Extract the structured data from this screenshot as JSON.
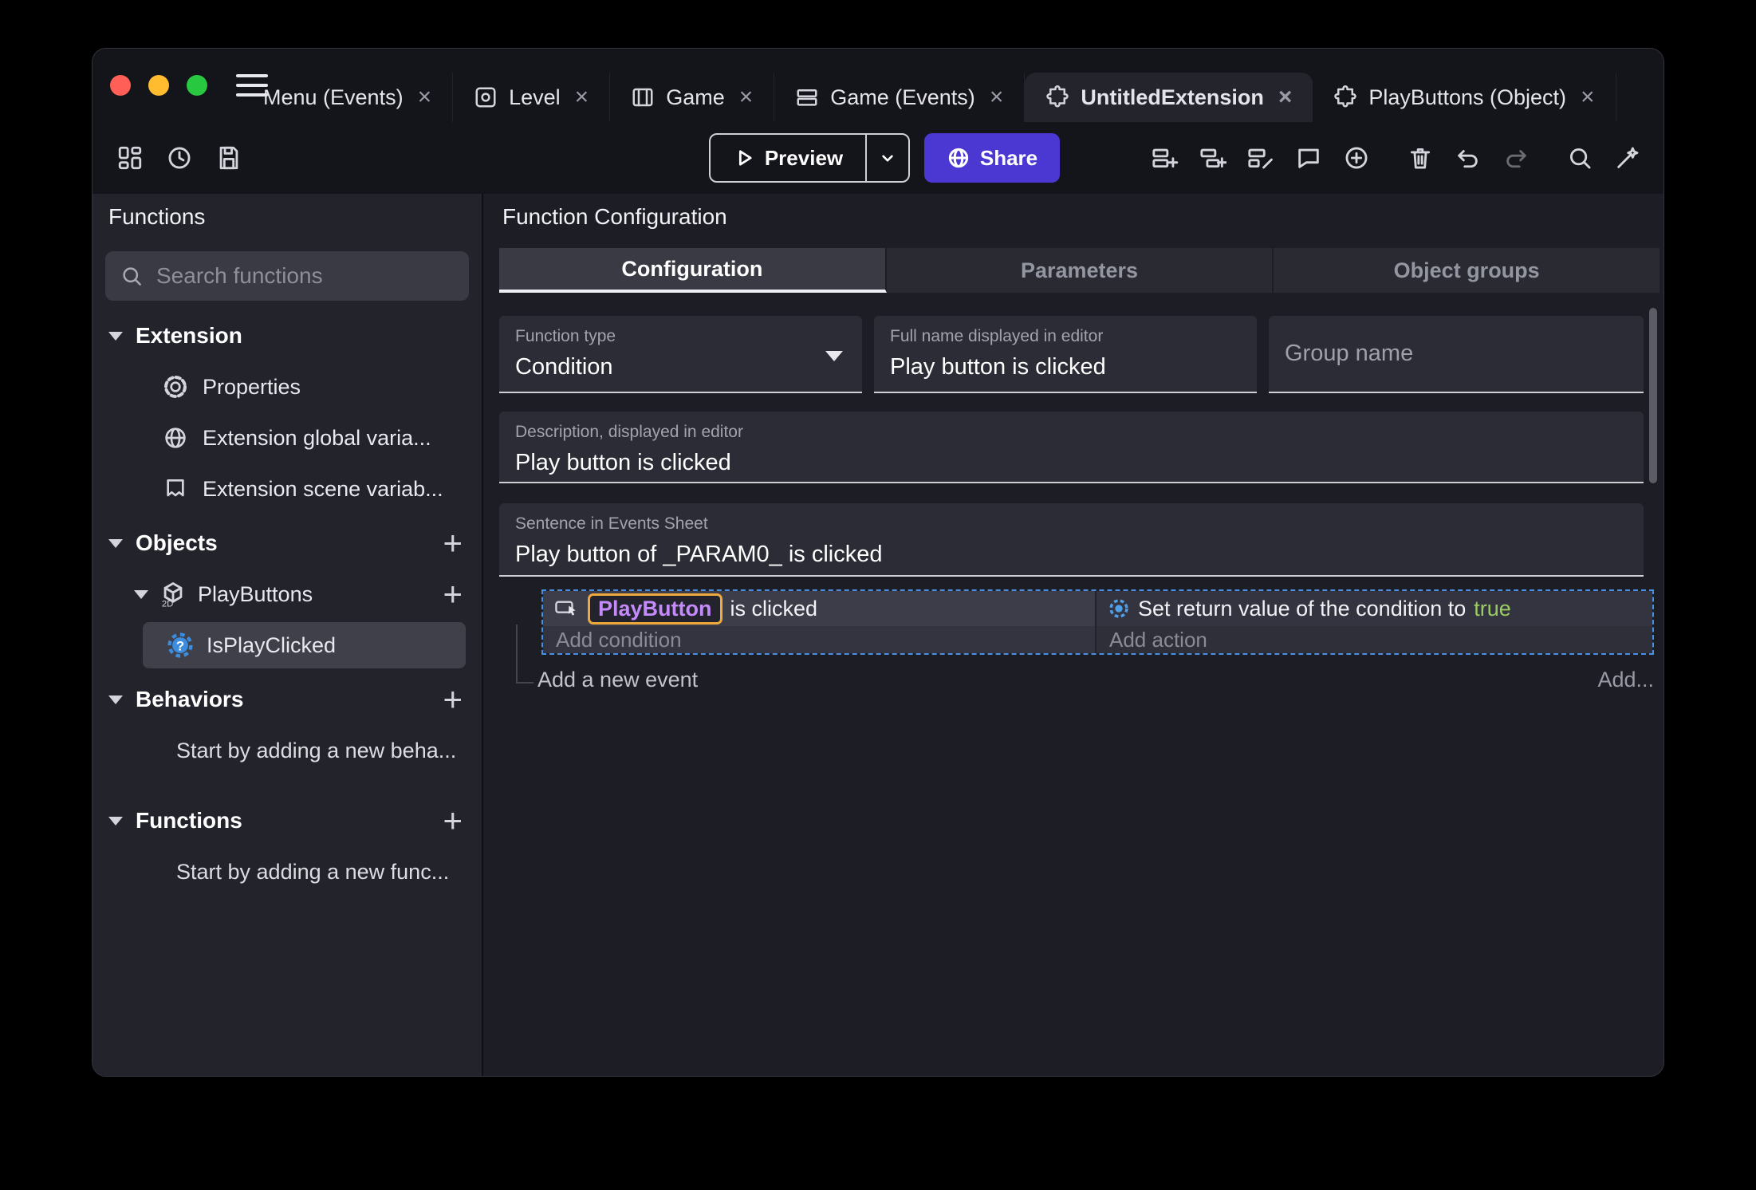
{
  "icons": {
    "close": "×",
    "plus": "+"
  },
  "colors": {
    "share_button": "#4b38d3",
    "event_selection_border": "#4a90e2",
    "object_highlight_text": "#c58af9",
    "object_highlight_border": "#eda93b",
    "true_value": "#9acd5f",
    "action_gear": "#4fa0e8",
    "traffic_red": "#ff5f57",
    "traffic_yellow": "#febc2e",
    "traffic_green": "#28c840"
  },
  "tabs": [
    {
      "label": "Menu (Events)"
    },
    {
      "label": "Level"
    },
    {
      "label": "Game"
    },
    {
      "label": "Game (Events)"
    },
    {
      "label": "UntitledExtension"
    },
    {
      "label": "PlayButtons (Object)"
    }
  ],
  "toolbar": {
    "preview": "Preview",
    "share": "Share"
  },
  "sidebar": {
    "title": "Functions",
    "search_placeholder": "Search functions",
    "extension": {
      "label": "Extension",
      "properties": "Properties",
      "global_vars": "Extension global varia...",
      "scene_vars": "Extension scene variab..."
    },
    "objects": {
      "label": "Objects",
      "playbuttons": "PlayButtons",
      "isplayclicked": "IsPlayClicked"
    },
    "behaviors": {
      "label": "Behaviors",
      "hint": "Start by adding a new beha..."
    },
    "functions": {
      "label": "Functions",
      "hint": "Start by adding a new func..."
    }
  },
  "main": {
    "title": "Function Configuration",
    "tabs": [
      {
        "label": "Configuration"
      },
      {
        "label": "Parameters"
      },
      {
        "label": "Object groups"
      }
    ],
    "function_type": {
      "label": "Function type",
      "value": "Condition"
    },
    "full_name": {
      "label": "Full name displayed in editor",
      "value": "Play button is clicked"
    },
    "group_name": {
      "placeholder": "Group name"
    },
    "description": {
      "label": "Description, displayed in editor",
      "value": "Play button is clicked"
    },
    "sentence": {
      "label": "Sentence in Events Sheet",
      "value": "Play button of _PARAM0_ is clicked"
    },
    "event": {
      "condition_object": "PlayButton",
      "condition_text": "is clicked",
      "add_condition": "Add condition",
      "action_text": "Set return value of the condition to",
      "action_value": "true",
      "add_action": "Add action",
      "add_new_event": "Add a new event",
      "add_more": "Add..."
    }
  }
}
